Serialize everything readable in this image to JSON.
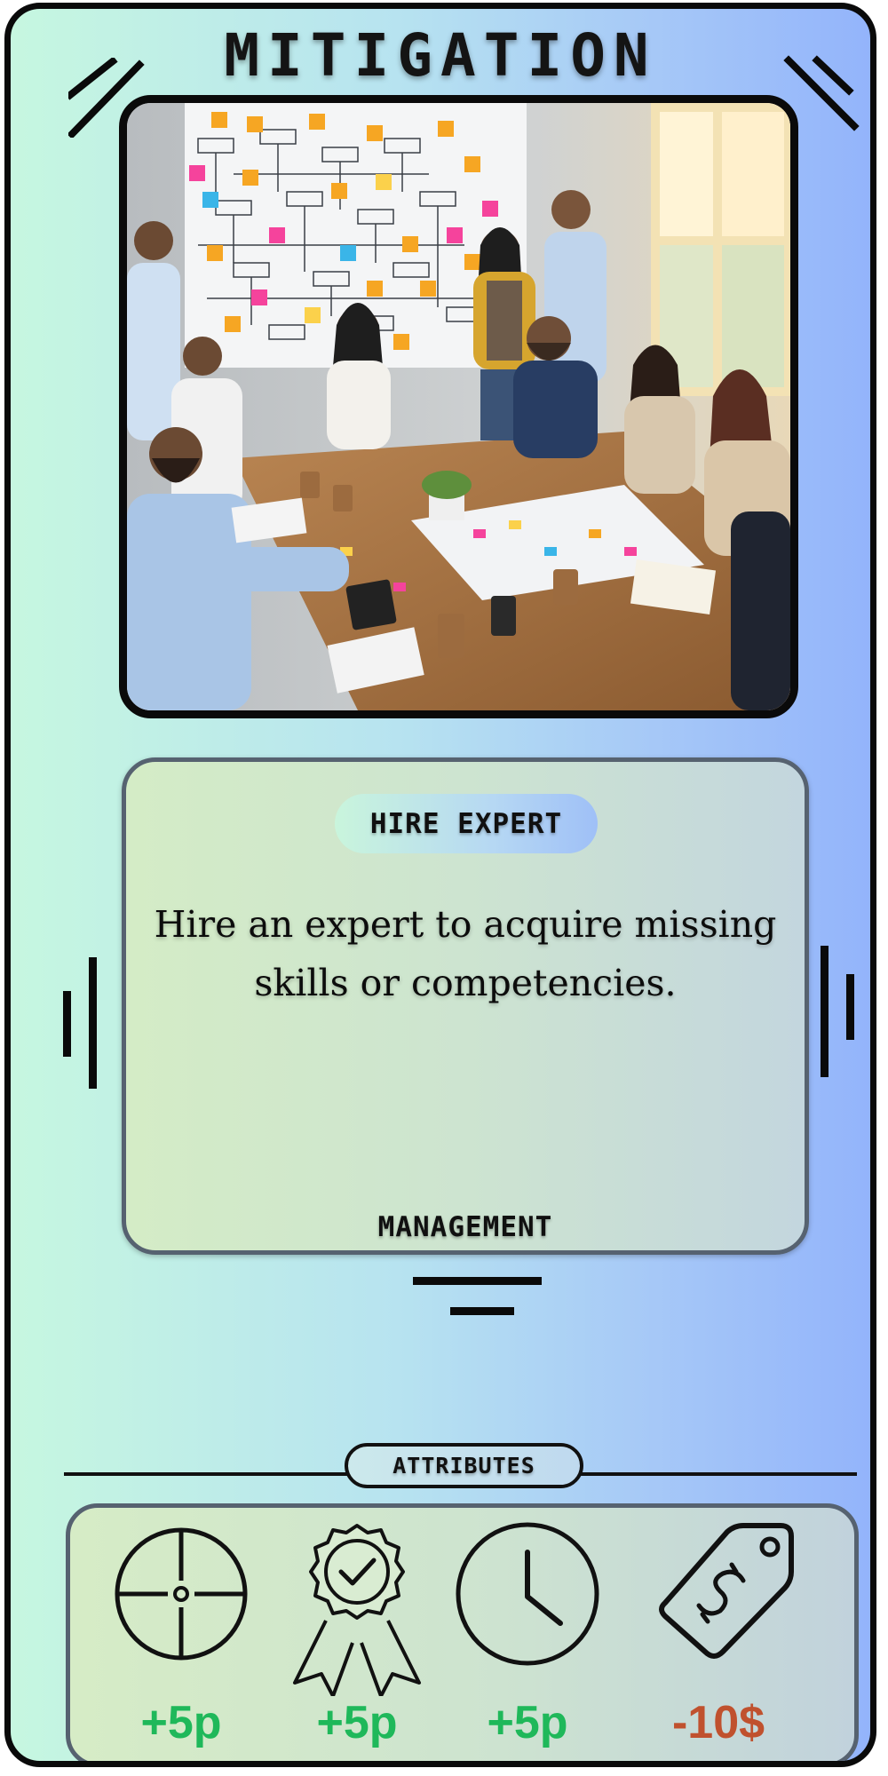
{
  "card": {
    "type_label": "MITIGATION",
    "name": "HIRE EXPERT",
    "description": "Hire an expert to acquire missing skills or competencies.",
    "category": "MANAGEMENT",
    "attributes_label": "ATTRIBUTES"
  },
  "image": {
    "icon": "team-meeting-photo"
  },
  "attributes": [
    {
      "icon": "crosshair-icon",
      "value": "+5p",
      "color": "#1fb85a"
    },
    {
      "icon": "award-badge-icon",
      "value": "+5p",
      "color": "#1fb85a"
    },
    {
      "icon": "clock-icon",
      "value": "+5p",
      "color": "#1fb85a"
    },
    {
      "icon": "price-tag-dollar-icon",
      "value": "-10$",
      "color": "#c0512e"
    }
  ],
  "colors": {
    "gradient_left": "#c6f7e0",
    "gradient_right": "#93b4fb",
    "positive": "#1fb85a",
    "negative": "#c0512e",
    "border": "#0a0a0a"
  }
}
